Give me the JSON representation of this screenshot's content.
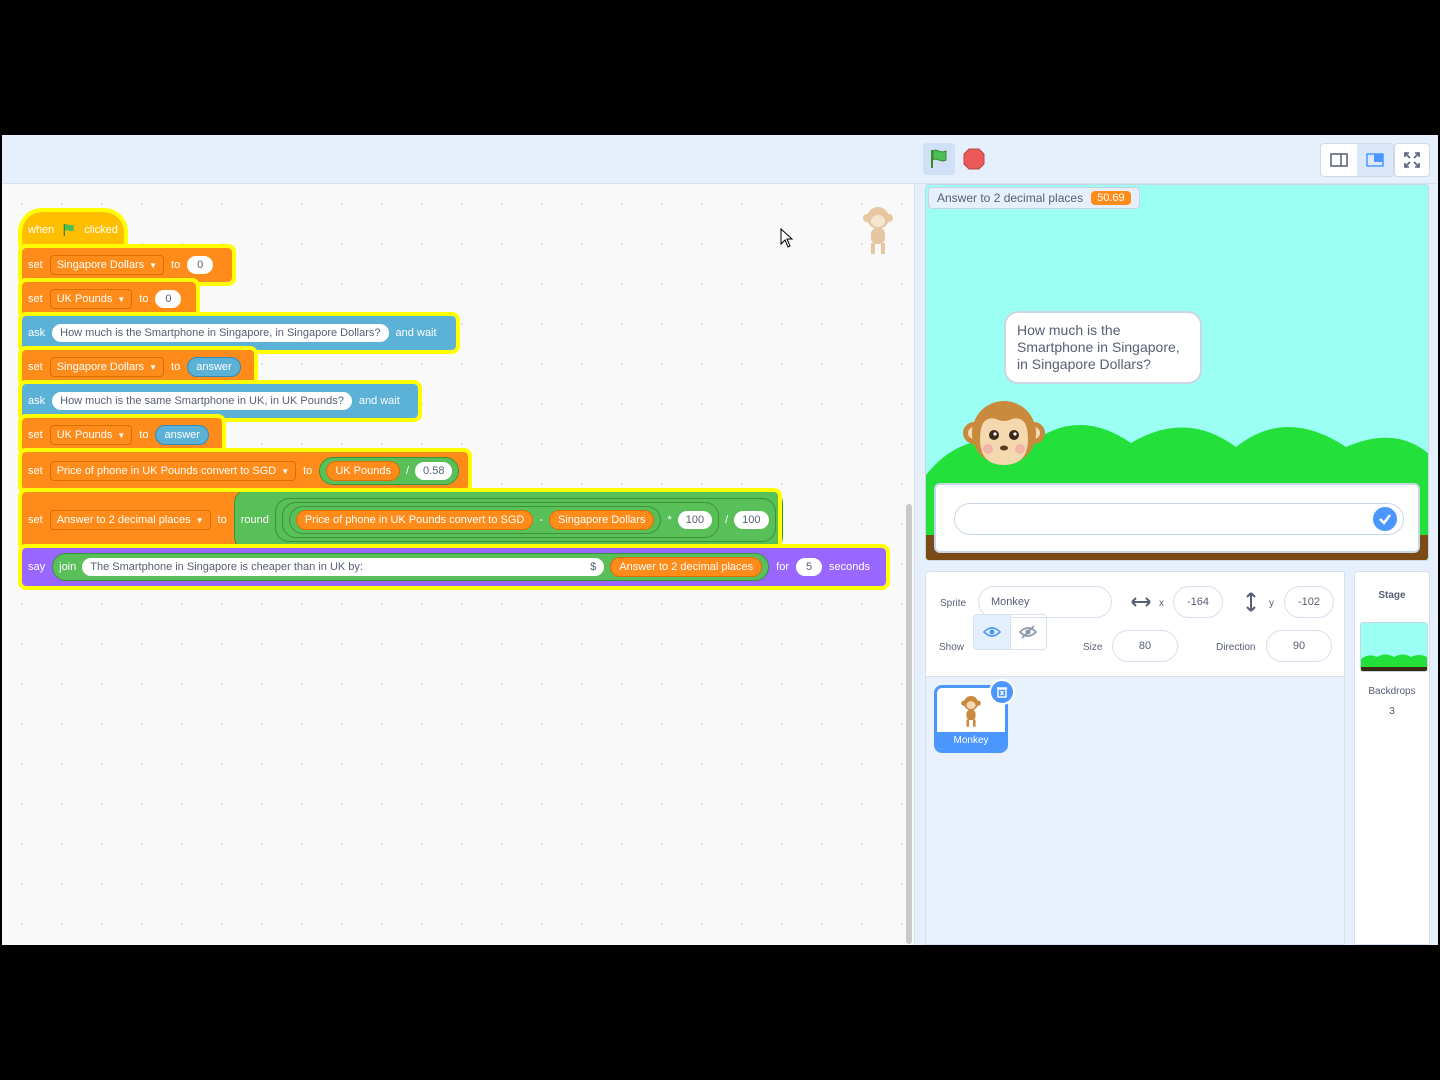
{
  "scripts": {
    "hat": {
      "when": "when",
      "clicked": "clicked"
    },
    "b1": {
      "kw": "set",
      "var": "Singapore Dollars",
      "to": "to",
      "value": "0"
    },
    "b2": {
      "kw": "set",
      "var": "UK Pounds",
      "to": "to",
      "value": "0"
    },
    "b3": {
      "kw": "ask",
      "text": "How much is the Smartphone in Singapore, in Singapore Dollars?",
      "wait": "and wait"
    },
    "b4": {
      "kw": "set",
      "var": "Singapore Dollars",
      "to": "to",
      "value": "answer"
    },
    "b5": {
      "kw": "ask",
      "text": "How much is the same Smartphone in UK, in UK Pounds?",
      "wait": "and wait"
    },
    "b6": {
      "kw": "set",
      "var": "UK Pounds",
      "to": "to",
      "value": "answer"
    },
    "b7": {
      "kw": "set",
      "var": "Price of phone in UK Pounds convert to SGD",
      "to": "to",
      "operand": "UK Pounds",
      "op": "/",
      "value": "0.58"
    },
    "b8": {
      "kw": "set",
      "var": "Answer to 2 decimal places",
      "to": "to",
      "round": "round",
      "operand1": "Price of phone in UK Pounds convert to SGD",
      "minus": "-",
      "operand2": "Singapore Dollars",
      "times": "*",
      "mult": "100",
      "div": "/",
      "divisor": "100"
    },
    "b9": {
      "kw": "say",
      "join": "join",
      "text": "The Smartphone in Singapore is cheaper than in UK by:",
      "dollar": "$",
      "operand": "Answer to 2 decimal places",
      "for": "for",
      "secs": "5",
      "seconds": "seconds"
    }
  },
  "stage": {
    "monitor_label": "Answer to 2 decimal places",
    "monitor_value": "50.69",
    "speech": "How much is the Smartphone in Singapore, in Singapore Dollars?",
    "ask_value": ""
  },
  "sprite_info": {
    "sprite_label": "Sprite",
    "sprite_name": "Monkey",
    "x_label": "x",
    "x": "-164",
    "y_label": "y",
    "y": "-102",
    "show_label": "Show",
    "size_label": "Size",
    "size": "80",
    "direction_label": "Direction",
    "direction": "90"
  },
  "sprites": [
    {
      "name": "Monkey"
    }
  ],
  "stage_pane": {
    "title": "Stage",
    "backdrops_label": "Backdrops",
    "backdrops_count": "3"
  },
  "colors": {
    "motion_blue": "#4c97ff",
    "variables": "#ff8c1a",
    "sensing": "#5cb1d6",
    "looks": "#9966ff",
    "operators": "#59c059",
    "events": "#ffbf00",
    "highlight": "#ffff00"
  },
  "icons": [
    "green-flag-icon",
    "stop-icon",
    "small-stage-icon",
    "large-stage-icon",
    "fullscreen-icon",
    "eye-icon",
    "eye-off-icon",
    "check-icon",
    "delete-icon",
    "monkey-sprite"
  ]
}
